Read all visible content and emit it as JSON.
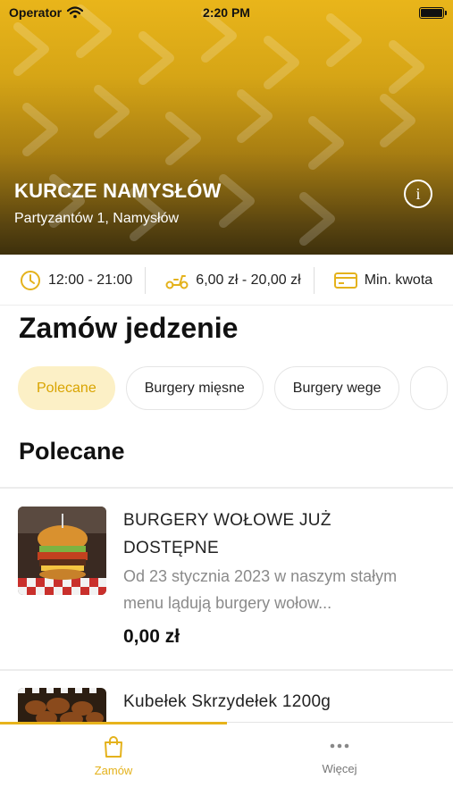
{
  "status_bar": {
    "carrier": "Operator",
    "time": "2:20 PM"
  },
  "restaurant": {
    "name": "KURCZE NAMYSŁÓW",
    "address": "Partyzantów 1, Namysłów",
    "info_icon": "info-icon"
  },
  "info_strip": [
    {
      "icon": "clock-icon",
      "text": "12:00 - 21:00"
    },
    {
      "icon": "scooter-icon",
      "text": "6,00 zł - 20,00 zł"
    },
    {
      "icon": "card-icon",
      "text": "Min. kwota"
    }
  ],
  "section_title": "Zamów jedzenie",
  "chips": [
    {
      "label": "Polecane",
      "active": true
    },
    {
      "label": "Burgery mięsne",
      "active": false
    },
    {
      "label": "Burgery wege",
      "active": false
    }
  ],
  "category_title": "Polecane",
  "products": [
    {
      "name": "BURGERY WOŁOWE JUŻ DOSTĘPNE",
      "description": "Od 23 stycznia 2023 w naszym stałym menu lądują burgery wołow...",
      "price": "0,00 zł"
    },
    {
      "name": "Kubełek Skrzydełek 1200g",
      "description": "",
      "price": ""
    }
  ],
  "tabs": [
    {
      "label": "Zamów",
      "icon": "bag-icon",
      "active": true
    },
    {
      "label": "Więcej",
      "icon": "more-icon",
      "active": false
    }
  ],
  "colors": {
    "accent": "#e7b31b",
    "chip_active_bg": "#fcf0c6",
    "chip_active_text": "#d9a400"
  }
}
